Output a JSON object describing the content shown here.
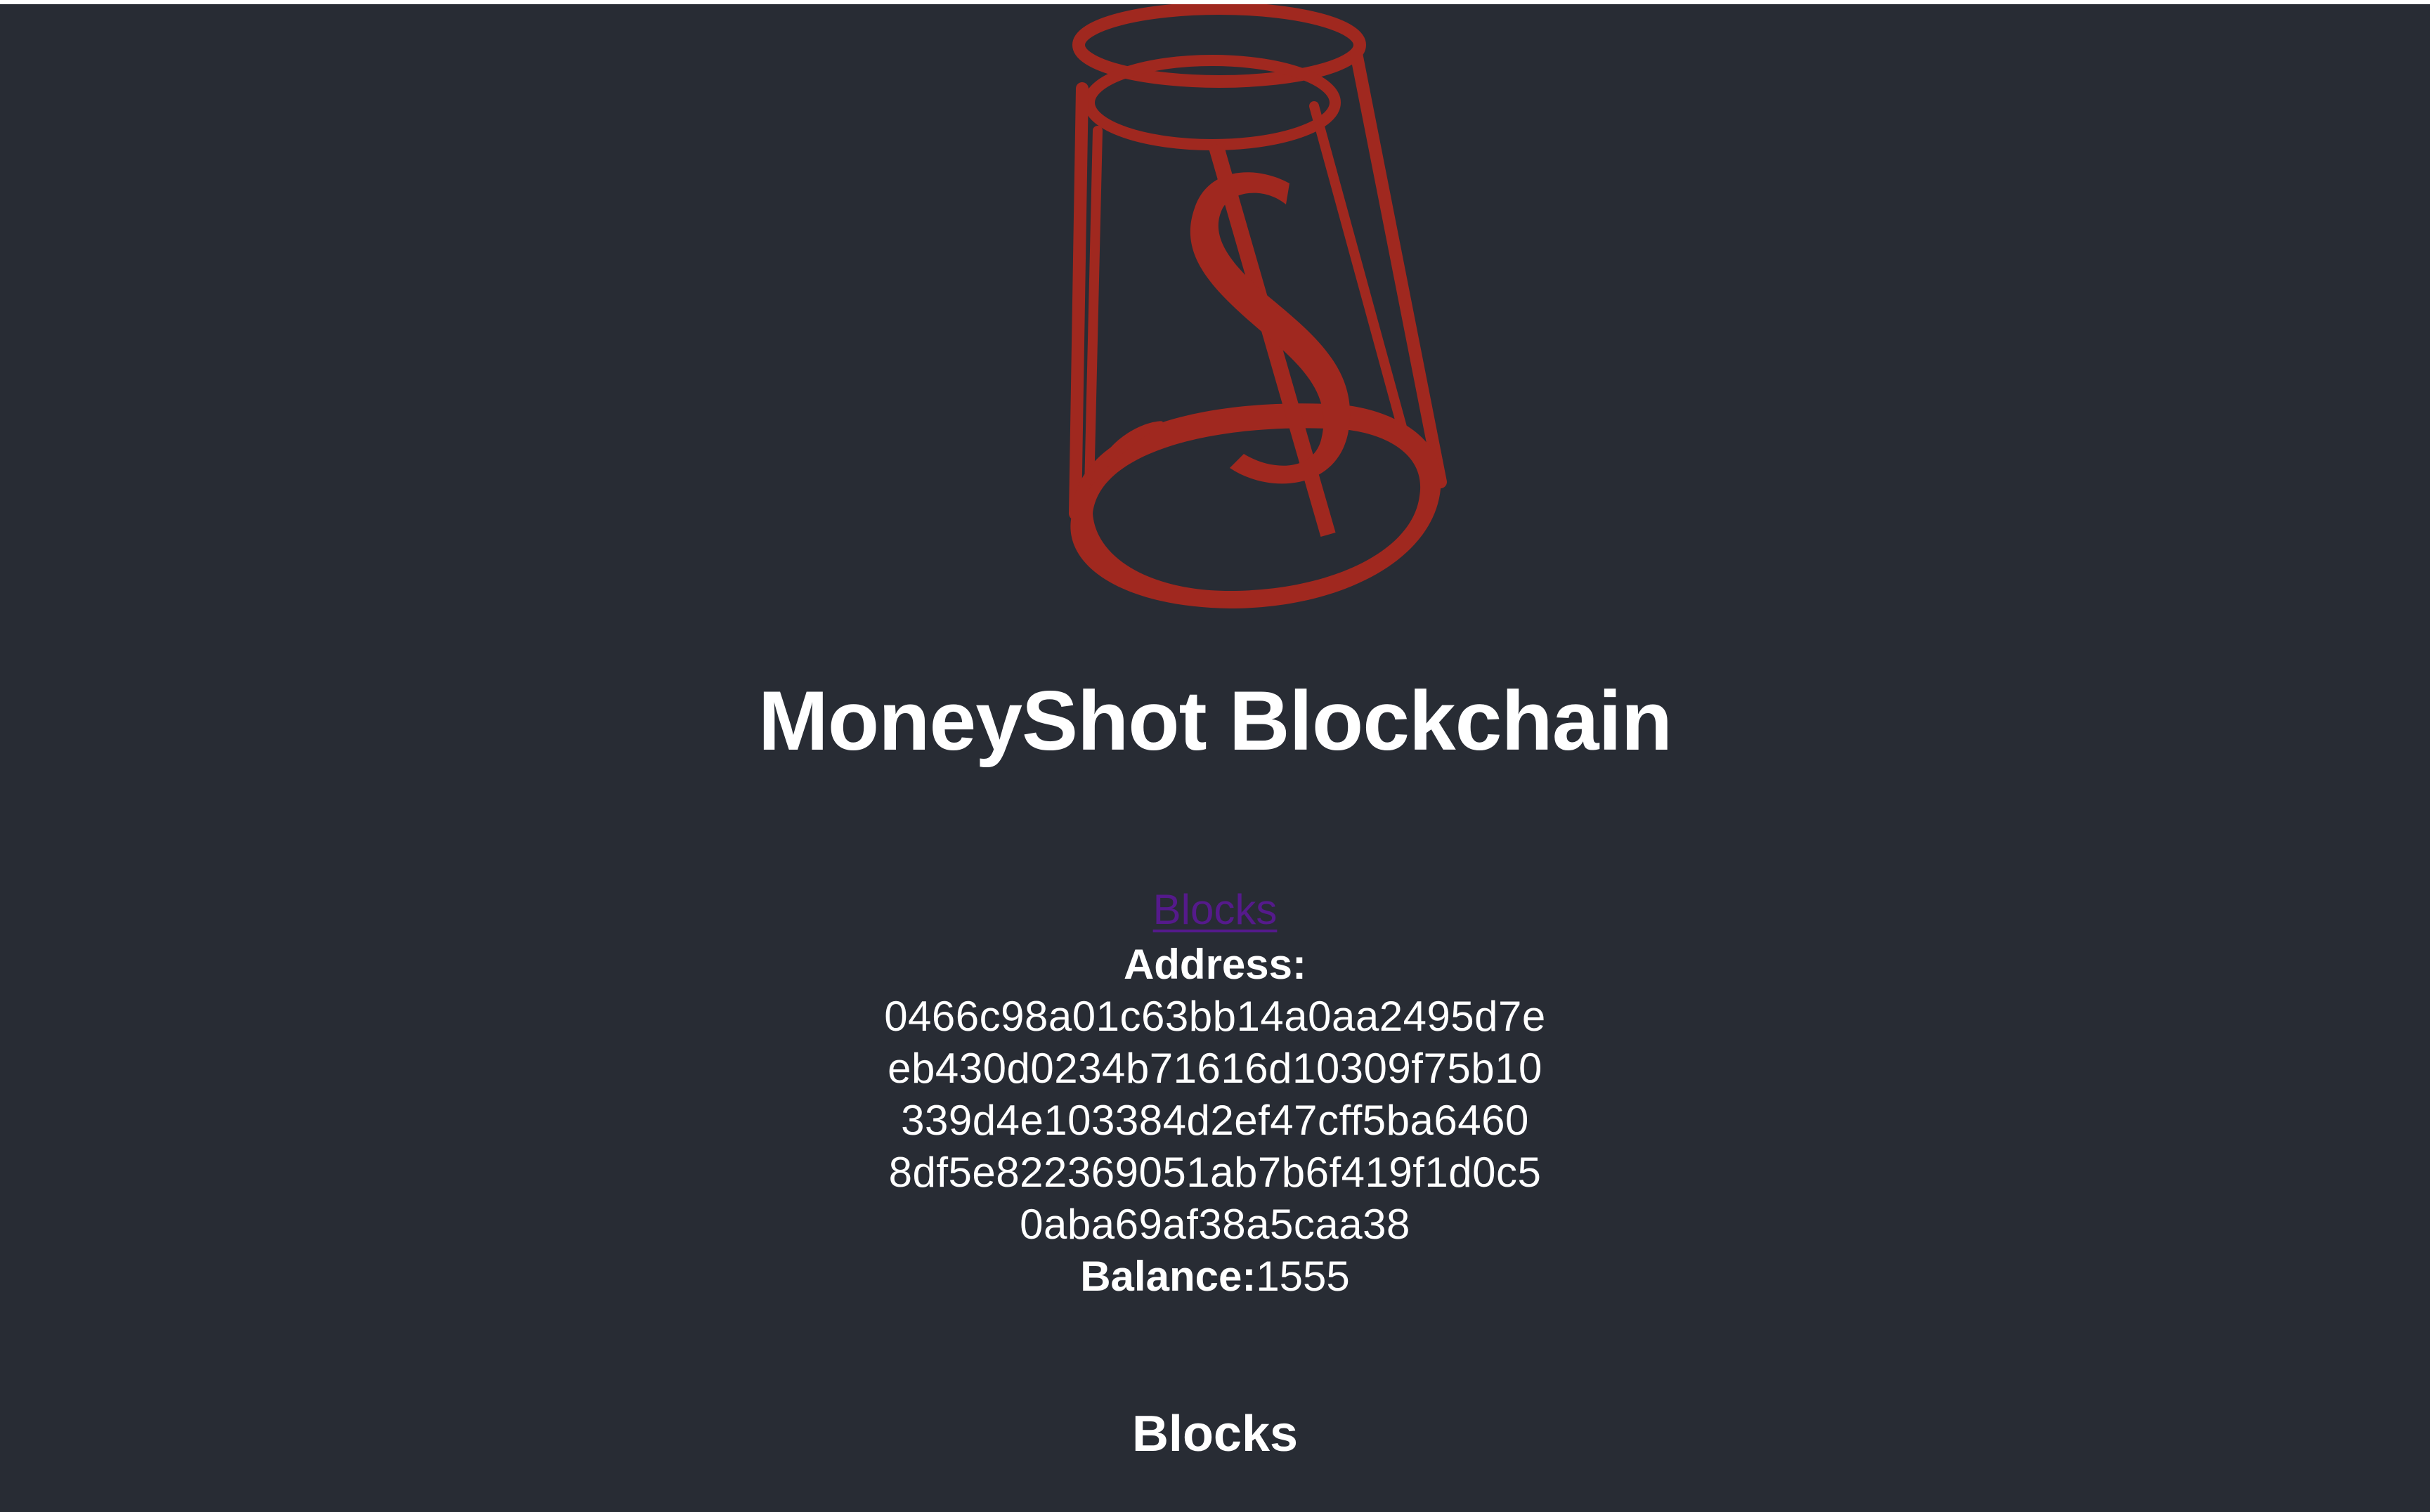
{
  "app": {
    "title": "MoneyShot Blockchain",
    "logo": {
      "icon": "shot-glass-dollar-icon",
      "color": "#a0281f"
    },
    "background_color": "#282c34"
  },
  "nav": {
    "blocks_link": "Blocks"
  },
  "wallet": {
    "address_label": "Address:",
    "address_lines": [
      "0466c98a01c63bb14a0aa2495d7e",
      "eb430d0234b71616d10309f75b10",
      "339d4e103384d2ef47cff5ba6460",
      "8df5e822369051ab7b6f419f1d0c5",
      "0aba69af38a5caa38"
    ],
    "balance_label": "Balance:",
    "balance_value": "1555"
  },
  "blocks_section": {
    "heading": "Blocks"
  }
}
